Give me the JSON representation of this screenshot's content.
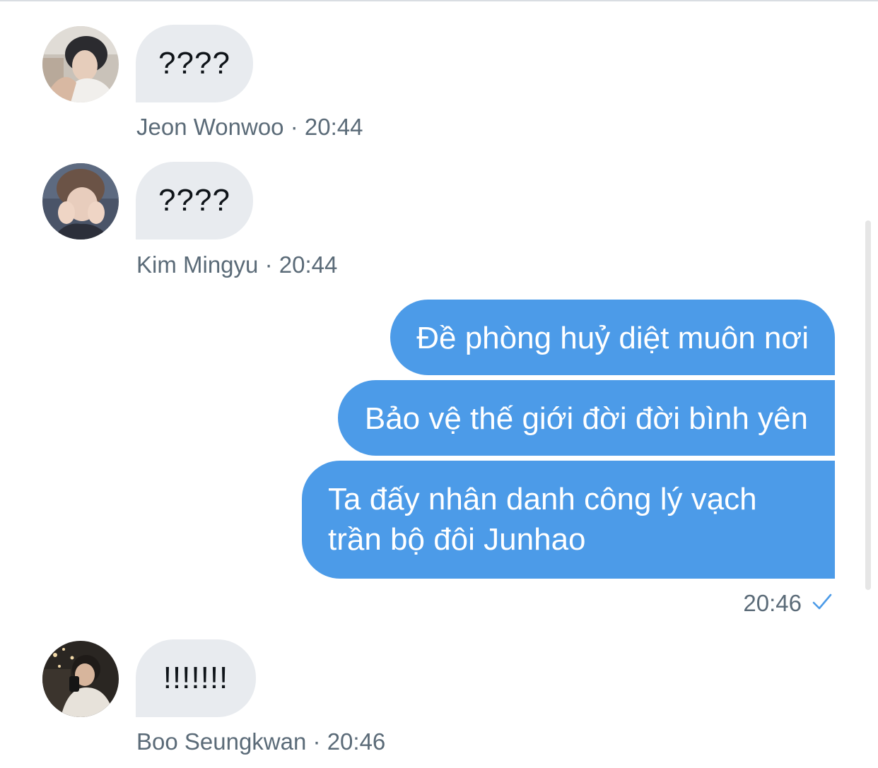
{
  "messages_in": [
    {
      "text": "????",
      "sender": "Jeon Wonwoo",
      "time": "20:44"
    },
    {
      "text": "????",
      "sender": "Kim Mingyu",
      "time": "20:44"
    },
    {
      "text": "!!!!!!!",
      "sender": "Boo Seungkwan",
      "time": "20:46"
    }
  ],
  "messages_out": [
    {
      "text": "Đề phòng huỷ diệt muôn nơi"
    },
    {
      "text": "Bảo vệ thế giới đời đời bình yên"
    },
    {
      "text": "Ta đấy nhân danh công lý vạch trần bộ đôi Junhao"
    }
  ],
  "outgoing_status": {
    "time": "20:46",
    "icon": "checkmark-icon"
  },
  "separator": "·",
  "colors": {
    "incoming_bubble": "#e8ebef",
    "outgoing_bubble": "#4c9be8",
    "meta_text": "#5b6b78",
    "check": "#4c9be8"
  }
}
